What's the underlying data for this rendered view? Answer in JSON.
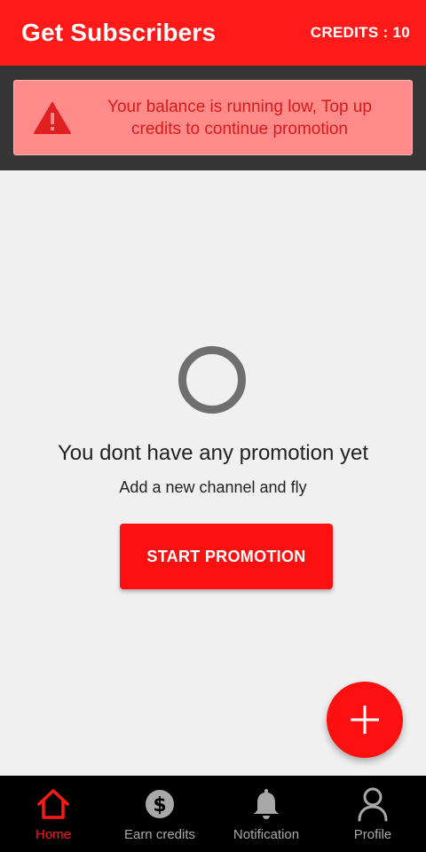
{
  "app_bar": {
    "title": "Get Subscribers",
    "credits": "CREDITS : 10"
  },
  "banner": {
    "icon": "warning-icon",
    "message": "Your balance is running low, Top up credits to continue promotion"
  },
  "empty_state": {
    "title": "You dont have any promotion yet",
    "subtitle": "Add a new channel and fly",
    "button_label": "START PROMOTION"
  },
  "fab": {
    "icon": "plus-icon"
  },
  "bottom_nav": {
    "items": [
      {
        "label": "Home",
        "icon": "home-icon",
        "active": true
      },
      {
        "label": "Earn credits",
        "icon": "dollar-icon",
        "active": false
      },
      {
        "label": "Notification",
        "icon": "bell-icon",
        "active": false
      },
      {
        "label": "Profile",
        "icon": "person-icon",
        "active": false
      }
    ]
  },
  "colors": {
    "primary": "#ff1a1a",
    "banner_bg": "#ff8a8a",
    "banner_text": "#d81b1b",
    "nav_bg": "#000000",
    "nav_inactive": "#a8a8a8"
  }
}
